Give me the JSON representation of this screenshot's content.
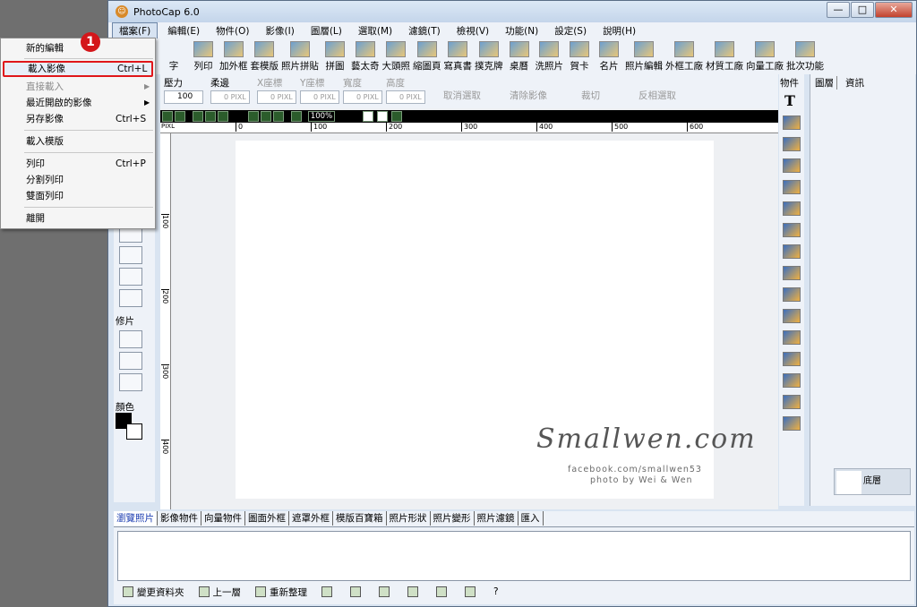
{
  "window": {
    "title": "PhotoCap 6.0",
    "minimize": "—",
    "maximize": "□",
    "close": "✕"
  },
  "menubar": [
    "檔案(F)",
    "編輯(E)",
    "物件(O)",
    "影像(I)",
    "圖層(L)",
    "選取(M)",
    "濾鏡(T)",
    "檢視(V)",
    "功能(N)",
    "設定(S)",
    "說明(H)"
  ],
  "toolbar": [
    "字",
    "列印",
    "加外框",
    "套模版",
    "照片拼貼",
    "拼圖",
    "藝太奇",
    "大頭照",
    "縮圖頁",
    "寫真書",
    "撲克牌",
    "桌曆",
    "洗照片",
    "賀卡",
    "名片",
    "照片編輯",
    "外框工廠",
    "材質工廠",
    "向量工廠",
    "批次功能"
  ],
  "properties": {
    "pressure": "壓力",
    "pressure_value": "100",
    "feather": "柔邊",
    "feather_value": "0 PIXL",
    "x": "X座標",
    "x_value": "0 PIXL",
    "y": "Y座標",
    "y_value": "0 PIXL",
    "width": "寬度",
    "width_value": "0 PIXL",
    "height": "高度",
    "height_value": "0 PIXL",
    "cancel_selection": "取消選取",
    "clear_image": "清除影像",
    "crop": "裁切",
    "invert_selection": "反相選取"
  },
  "view": {
    "zoom": "100%",
    "ruler_unit": "PIXL"
  },
  "ruler": {
    "top": [
      "0",
      "100",
      "200",
      "300",
      "400",
      "500",
      "600"
    ],
    "left": [
      "100",
      "200",
      "300",
      "400"
    ]
  },
  "left_panel": {
    "retouch": "修片",
    "color": "顏色"
  },
  "objects_panel": {
    "label": "物件"
  },
  "layers_panel": {
    "tab_layers": "圖層",
    "tab_info": "資訊",
    "base_layer": "底層"
  },
  "watermark": {
    "brand": "Smallwen.com",
    "facebook": "facebook.com/smallwen53",
    "credit": "photo by Wei & Wen"
  },
  "bottom_tabs": [
    "瀏覽照片",
    "影像物件",
    "向量物件",
    "圖面外框",
    "遮罩外框",
    "模版百寶箱",
    "照片形狀",
    "照片變形",
    "照片濾鏡",
    "匯入"
  ],
  "bottom_bar": {
    "change_folder": "變更資料夾",
    "up_level": "上一層",
    "refresh": "重新整理",
    "help": "?"
  },
  "file_menu": [
    {
      "label": "新的編輯",
      "shortcut": ""
    },
    {
      "label": "載入影像",
      "shortcut": "Ctrl+L"
    },
    {
      "label": "直接載入",
      "shortcut": ""
    },
    {
      "label": "最近開啟的影像",
      "shortcut": ""
    },
    {
      "label": "另存影像",
      "shortcut": "Ctrl+S"
    },
    {
      "label": "載入模版",
      "shortcut": ""
    },
    {
      "label": "列印",
      "shortcut": "Ctrl+P"
    },
    {
      "label": "分割列印",
      "shortcut": ""
    },
    {
      "label": "雙面列印",
      "shortcut": ""
    },
    {
      "label": "離開",
      "shortcut": ""
    }
  ],
  "step_badge": "1"
}
